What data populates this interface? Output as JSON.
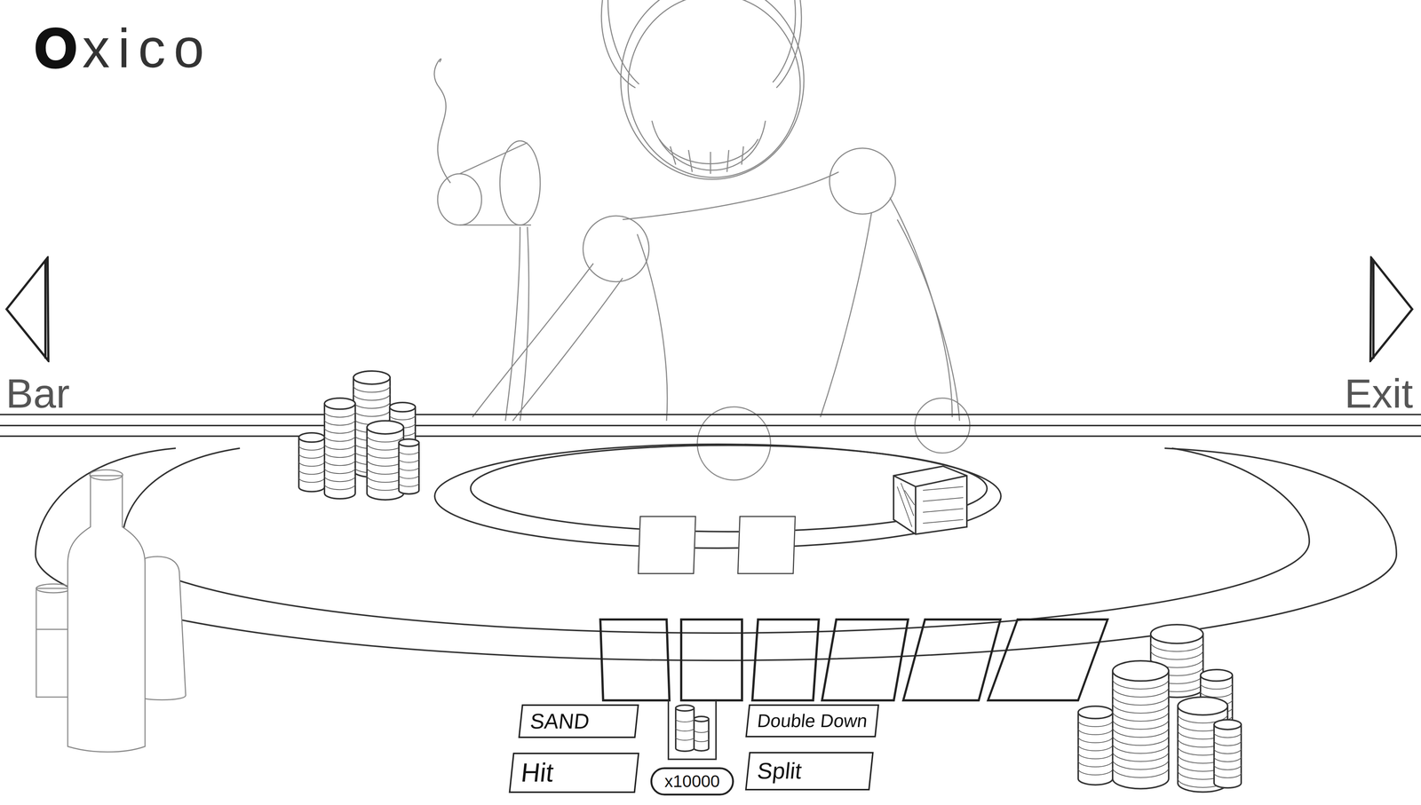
{
  "game": {
    "logo": {
      "initial": "O",
      "rest": "xico"
    }
  },
  "navigation": [
    {
      "label": "Bar",
      "kind": "left"
    },
    {
      "label": "Exit",
      "kind": "right"
    }
  ],
  "dealer": {
    "cards": [
      {
        "kind": "blank"
      },
      {
        "kind": "blank"
      }
    ]
  },
  "player": {
    "cards": [
      {
        "kind": "blank"
      },
      {
        "kind": "blank"
      },
      {
        "kind": "blank"
      },
      {
        "kind": "blank"
      },
      {
        "kind": "blank"
      },
      {
        "kind": "blank"
      }
    ]
  },
  "actions": {
    "left": [
      {
        "label": "SAND"
      },
      {
        "label": "Hit"
      }
    ],
    "right": [
      {
        "label": "Double Down"
      },
      {
        "label": "Split"
      }
    ]
  },
  "bet": {
    "amount": "x10000"
  }
}
